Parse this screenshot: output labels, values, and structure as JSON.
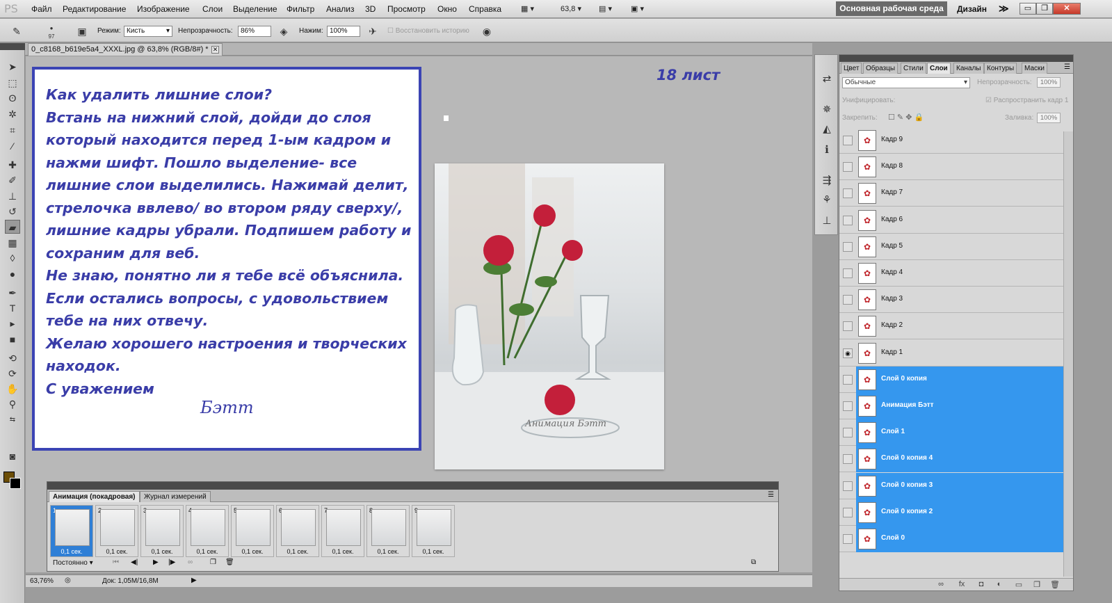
{
  "app": {
    "logo": "PS"
  },
  "menu": [
    "Файл",
    "Редактирование",
    "Изображение",
    "Слои",
    "Выделение",
    "Фильтр",
    "Анализ",
    "3D",
    "Просмотр",
    "Окно",
    "Справка"
  ],
  "menubar_zoom": "63,8",
  "workspace": {
    "main": "Основная рабочая среда",
    "design": "Дизайн",
    "more": "≫"
  },
  "window_buttons": {
    "minimize": "▭",
    "restore": "❐",
    "close": "✕"
  },
  "options": {
    "brush_size": "97",
    "mode_label": "Режим:",
    "mode_value": "Кисть",
    "opacity_label": "Непрозрачность:",
    "opacity_value": "86%",
    "pressure_label": "Нажим:",
    "pressure_value": "100%",
    "restore_history": "Восстановить историю"
  },
  "document": {
    "tab": "0_c8168_b619e5a4_XXXL.jpg @ 63,8% (RGB/8#) *",
    "close": "✕"
  },
  "canvas": {
    "text_lines": [
      "Как удалить лишние слои?",
      "Встань на нижний слой, дойди до слоя",
      "который находится перед 1-ым кадром и",
      "нажми шифт. Пошло выделение- все",
      "лишние слои выделились. Нажимай делит,",
      "стрелочка ввлево/ во втором ряду сверху/,",
      "лишние кадры убрали. Подпишем работу и",
      "сохраним для веб.",
      "Не знаю, понятно ли я тебе всё объяснила.",
      "Если остались вопросы, с удовольствием",
      "тебе на них отвечу.",
      "Желаю хорошего настроения и творческих",
      "находок.",
      "С уважением"
    ],
    "signature": "Бэтт",
    "sheet_label": "18 лист",
    "photo_watermark": "Анимация Бэтт"
  },
  "animation": {
    "tabs": [
      "Анимация (покадровая)",
      "Журнал измерений"
    ],
    "frames": [
      {
        "num": "1",
        "time": "0,1 сек."
      },
      {
        "num": "2",
        "time": "0,1 сек."
      },
      {
        "num": "3",
        "time": "0,1 сек."
      },
      {
        "num": "4",
        "time": "0,1 сек."
      },
      {
        "num": "5",
        "time": "0,1 сек."
      },
      {
        "num": "6",
        "time": "0,1 сек."
      },
      {
        "num": "7",
        "time": "0,1 сек."
      },
      {
        "num": "8",
        "time": "0,1 сек."
      },
      {
        "num": "9",
        "time": "0,1 сек."
      }
    ],
    "loop": "Постоянно"
  },
  "status": {
    "zoom": "63,76%",
    "doc": "Док: 1,05M/16,8M"
  },
  "layers_panel": {
    "tabs": [
      "Цвет",
      "Образцы",
      "Стили",
      "Слои",
      "Каналы",
      "Контуры",
      "Маски"
    ],
    "blend_mode": "Обычные",
    "opacity_label": "Непрозрачность:",
    "opacity_value": "100%",
    "unify_label": "Унифицировать:",
    "propagate_label": "Распространить кадр 1",
    "lock_label": "Закрепить:",
    "fill_label": "Заливка:",
    "fill_value": "100%",
    "layers": [
      {
        "name": "Кадр 9",
        "selected": false,
        "visible": false
      },
      {
        "name": "Кадр 8",
        "selected": false,
        "visible": false
      },
      {
        "name": "Кадр 7",
        "selected": false,
        "visible": false
      },
      {
        "name": "Кадр 6",
        "selected": false,
        "visible": false
      },
      {
        "name": "Кадр 5",
        "selected": false,
        "visible": false
      },
      {
        "name": "Кадр 4",
        "selected": false,
        "visible": false
      },
      {
        "name": "Кадр 3",
        "selected": false,
        "visible": false
      },
      {
        "name": "Кадр 2",
        "selected": false,
        "visible": false
      },
      {
        "name": "Кадр 1",
        "selected": false,
        "visible": true
      },
      {
        "name": "Слой 0 копия",
        "selected": true,
        "visible": false
      },
      {
        "name": "Анимация Бэтт",
        "selected": true,
        "visible": false
      },
      {
        "name": "Слой 1",
        "selected": true,
        "visible": false
      },
      {
        "name": "Слой 0 копия 4",
        "selected": true,
        "visible": false
      },
      {
        "name": "Слой 0 копия 3",
        "selected": true,
        "visible": false
      },
      {
        "name": "Слой 0 копия 2",
        "selected": true,
        "visible": false
      },
      {
        "name": "Слой 0",
        "selected": true,
        "visible": false
      }
    ]
  },
  "colors": {
    "accent_selection": "#3597ee",
    "text_blue": "#3a3da8",
    "foreground": "#6b4d06",
    "background": "#000000"
  }
}
